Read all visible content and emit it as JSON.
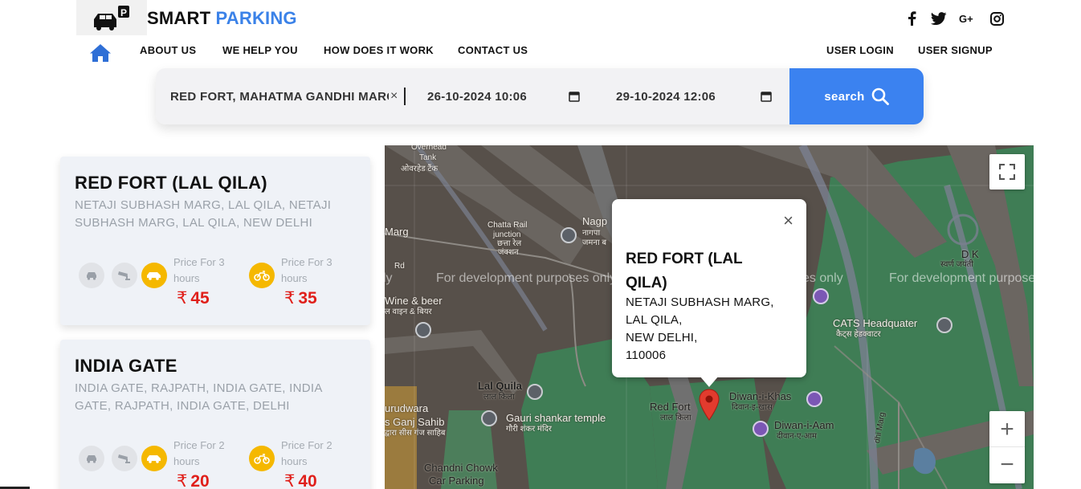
{
  "brand": {
    "part1": "SMART",
    "part2": "PARKING",
    "logo": "car-parking-logo-icon"
  },
  "social": [
    "facebook-icon",
    "twitter-icon",
    "google-plus-icon",
    "instagram-icon"
  ],
  "nav": {
    "home": "home-icon",
    "links": [
      "ABOUT US",
      "WE HELP YOU",
      "HOW DOES IT WORK",
      "CONTACT US"
    ],
    "user_login": "USER LOGIN",
    "user_signup": "USER SIGNUP"
  },
  "search": {
    "location": "RED FORT, MAHATMA GANDHI MARG",
    "clear": "×",
    "start": "26-10-2024 10:06",
    "end": "29-10-2024 12:06",
    "button": "search"
  },
  "cards": [
    {
      "title": "RED FORT (LAL QILA)",
      "address": "NETAJI SUBHASH MARG, LAL QILA, NETAJI SUBHASH MARG, LAL QILA, NEW DELHI",
      "car_label": "Price For 3 hours",
      "car_price": "45",
      "bike_label": "Price For 3 hours",
      "bike_price": "35"
    },
    {
      "title": "INDIA GATE",
      "address": "INDIA GATE, RAJPATH, INDIA GATE, INDIA GATE, RAJPATH, INDIA GATE, DELHI",
      "car_label": "Price For 2 hours",
      "car_price": "20",
      "bike_label": "Price For 2 hours",
      "bike_price": "40"
    }
  ],
  "currency": "₹",
  "map": {
    "dev_text": "For development purposes only",
    "labels": {
      "overhead": "Overhead",
      "tank": "Tank",
      "tank_hi": "ओवरहेड टैंक",
      "marg": "Marg",
      "rd": "Rd",
      "chatta": "Chatta Rail",
      "junction": "junction",
      "chatta_hi": "छत्ता रेल",
      "junction_hi": "जंक्शन",
      "nagp": "Nagp",
      "nagp_hi": "नागपा",
      "jamna_hi": "जमना ब",
      "wine": "Wine & beer",
      "wine_hi": "ल वाइन & बियर",
      "lal_qila": "Lal Quila",
      "lal_qila_hi": "लाल किला",
      "red_fort": "Red Fort",
      "red_fort_hi": "लाल किला",
      "diwan_khas": "Diwan-i-Khas",
      "diwan_khas_hi": "दिवान-इ-खास",
      "diwan_aam": "Diwan-i-Aam",
      "diwan_aam_hi": "दीवान-ए-आम",
      "gauri": "Gauri shankar temple",
      "gauri_hi": "गौरी शंकर मंदिर",
      "gurudwara": "urudwara",
      "sis_ganj": "s Ganj Sahib",
      "sis_ganj_hi": "द्वारा सीस गंज साहिब",
      "chandni": "Chandni Chowk",
      "car_parking": "Car Parking",
      "cats": "CATS Headquater",
      "cats_hi": "कैट्स हेडक्वाटर",
      "dk": "D K",
      "dk_hi": "स्वर्ण जयंती",
      "dhi_marg": "dhi Marg",
      "ly": "ly"
    },
    "popup": {
      "title": "RED FORT (LAL QILA)",
      "lines": [
        "NETAJI SUBHASH MARG,",
        "LAL QILA,",
        "NEW DELHI,",
        "110006"
      ],
      "close": "×"
    },
    "controls": {
      "zoom_in": "+",
      "zoom_out": "−"
    }
  }
}
